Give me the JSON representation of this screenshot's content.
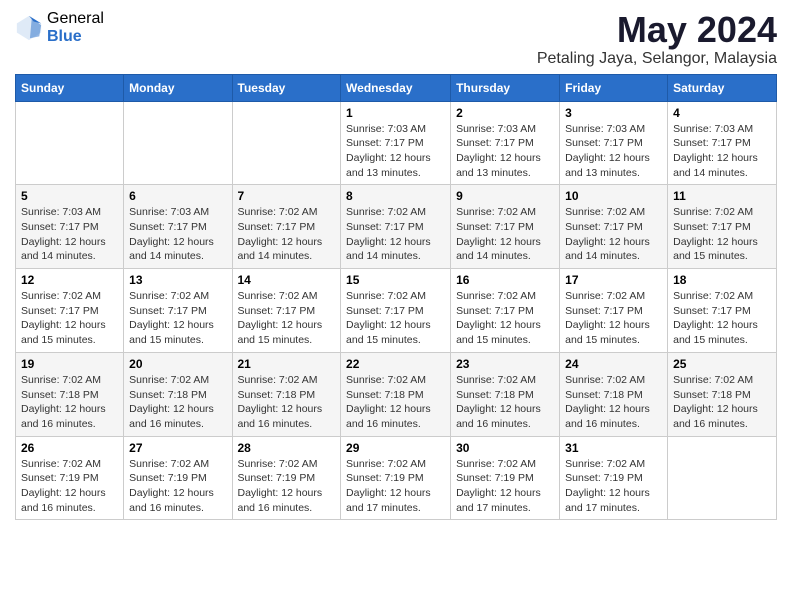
{
  "logo": {
    "general": "General",
    "blue": "Blue"
  },
  "title": "May 2024",
  "location": "Petaling Jaya, Selangor, Malaysia",
  "days_of_week": [
    "Sunday",
    "Monday",
    "Tuesday",
    "Wednesday",
    "Thursday",
    "Friday",
    "Saturday"
  ],
  "weeks": [
    [
      {
        "day": "",
        "info": ""
      },
      {
        "day": "",
        "info": ""
      },
      {
        "day": "",
        "info": ""
      },
      {
        "day": "1",
        "info": "Sunrise: 7:03 AM\nSunset: 7:17 PM\nDaylight: 12 hours\nand 13 minutes."
      },
      {
        "day": "2",
        "info": "Sunrise: 7:03 AM\nSunset: 7:17 PM\nDaylight: 12 hours\nand 13 minutes."
      },
      {
        "day": "3",
        "info": "Sunrise: 7:03 AM\nSunset: 7:17 PM\nDaylight: 12 hours\nand 13 minutes."
      },
      {
        "day": "4",
        "info": "Sunrise: 7:03 AM\nSunset: 7:17 PM\nDaylight: 12 hours\nand 14 minutes."
      }
    ],
    [
      {
        "day": "5",
        "info": "Sunrise: 7:03 AM\nSunset: 7:17 PM\nDaylight: 12 hours\nand 14 minutes."
      },
      {
        "day": "6",
        "info": "Sunrise: 7:03 AM\nSunset: 7:17 PM\nDaylight: 12 hours\nand 14 minutes."
      },
      {
        "day": "7",
        "info": "Sunrise: 7:02 AM\nSunset: 7:17 PM\nDaylight: 12 hours\nand 14 minutes."
      },
      {
        "day": "8",
        "info": "Sunrise: 7:02 AM\nSunset: 7:17 PM\nDaylight: 12 hours\nand 14 minutes."
      },
      {
        "day": "9",
        "info": "Sunrise: 7:02 AM\nSunset: 7:17 PM\nDaylight: 12 hours\nand 14 minutes."
      },
      {
        "day": "10",
        "info": "Sunrise: 7:02 AM\nSunset: 7:17 PM\nDaylight: 12 hours\nand 14 minutes."
      },
      {
        "day": "11",
        "info": "Sunrise: 7:02 AM\nSunset: 7:17 PM\nDaylight: 12 hours\nand 15 minutes."
      }
    ],
    [
      {
        "day": "12",
        "info": "Sunrise: 7:02 AM\nSunset: 7:17 PM\nDaylight: 12 hours\nand 15 minutes."
      },
      {
        "day": "13",
        "info": "Sunrise: 7:02 AM\nSunset: 7:17 PM\nDaylight: 12 hours\nand 15 minutes."
      },
      {
        "day": "14",
        "info": "Sunrise: 7:02 AM\nSunset: 7:17 PM\nDaylight: 12 hours\nand 15 minutes."
      },
      {
        "day": "15",
        "info": "Sunrise: 7:02 AM\nSunset: 7:17 PM\nDaylight: 12 hours\nand 15 minutes."
      },
      {
        "day": "16",
        "info": "Sunrise: 7:02 AM\nSunset: 7:17 PM\nDaylight: 12 hours\nand 15 minutes."
      },
      {
        "day": "17",
        "info": "Sunrise: 7:02 AM\nSunset: 7:17 PM\nDaylight: 12 hours\nand 15 minutes."
      },
      {
        "day": "18",
        "info": "Sunrise: 7:02 AM\nSunset: 7:17 PM\nDaylight: 12 hours\nand 15 minutes."
      }
    ],
    [
      {
        "day": "19",
        "info": "Sunrise: 7:02 AM\nSunset: 7:18 PM\nDaylight: 12 hours\nand 16 minutes."
      },
      {
        "day": "20",
        "info": "Sunrise: 7:02 AM\nSunset: 7:18 PM\nDaylight: 12 hours\nand 16 minutes."
      },
      {
        "day": "21",
        "info": "Sunrise: 7:02 AM\nSunset: 7:18 PM\nDaylight: 12 hours\nand 16 minutes."
      },
      {
        "day": "22",
        "info": "Sunrise: 7:02 AM\nSunset: 7:18 PM\nDaylight: 12 hours\nand 16 minutes."
      },
      {
        "day": "23",
        "info": "Sunrise: 7:02 AM\nSunset: 7:18 PM\nDaylight: 12 hours\nand 16 minutes."
      },
      {
        "day": "24",
        "info": "Sunrise: 7:02 AM\nSunset: 7:18 PM\nDaylight: 12 hours\nand 16 minutes."
      },
      {
        "day": "25",
        "info": "Sunrise: 7:02 AM\nSunset: 7:18 PM\nDaylight: 12 hours\nand 16 minutes."
      }
    ],
    [
      {
        "day": "26",
        "info": "Sunrise: 7:02 AM\nSunset: 7:19 PM\nDaylight: 12 hours\nand 16 minutes."
      },
      {
        "day": "27",
        "info": "Sunrise: 7:02 AM\nSunset: 7:19 PM\nDaylight: 12 hours\nand 16 minutes."
      },
      {
        "day": "28",
        "info": "Sunrise: 7:02 AM\nSunset: 7:19 PM\nDaylight: 12 hours\nand 16 minutes."
      },
      {
        "day": "29",
        "info": "Sunrise: 7:02 AM\nSunset: 7:19 PM\nDaylight: 12 hours\nand 17 minutes."
      },
      {
        "day": "30",
        "info": "Sunrise: 7:02 AM\nSunset: 7:19 PM\nDaylight: 12 hours\nand 17 minutes."
      },
      {
        "day": "31",
        "info": "Sunrise: 7:02 AM\nSunset: 7:19 PM\nDaylight: 12 hours\nand 17 minutes."
      },
      {
        "day": "",
        "info": ""
      }
    ]
  ]
}
